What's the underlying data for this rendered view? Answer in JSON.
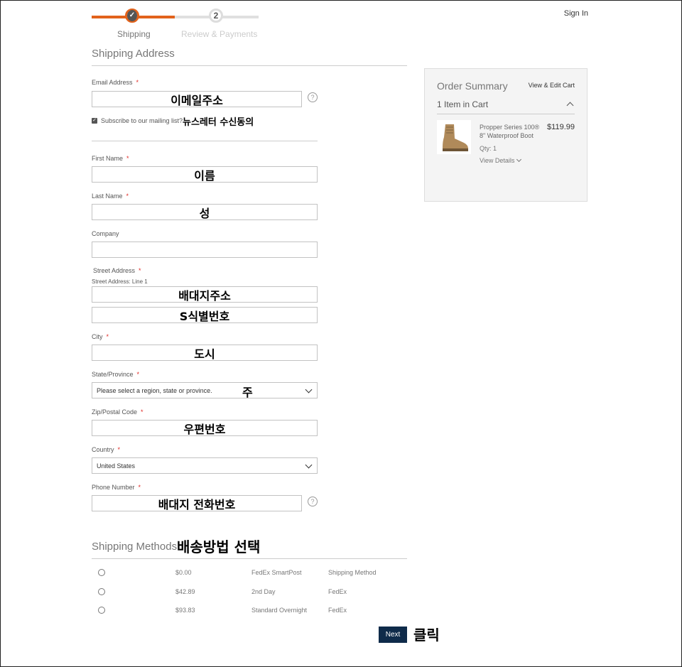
{
  "header": {
    "steps": [
      {
        "label": "Shipping",
        "state": "done",
        "icon": "check-icon"
      },
      {
        "label": "Review & Payments",
        "number": "2",
        "state": "pending"
      }
    ],
    "sign_in": "Sign In"
  },
  "shipping_address": {
    "title": "Shipping Address",
    "email": {
      "label": "Email Address",
      "annotation": "이메일주소"
    },
    "subscribe": {
      "label": "Subscribe to our mailing list?",
      "checked": true,
      "annotation": "뉴스레터 수신동의"
    },
    "first_name": {
      "label": "First Name",
      "annotation": "이름"
    },
    "last_name": {
      "label": "Last Name",
      "annotation": "성"
    },
    "company": {
      "label": "Company"
    },
    "street": {
      "label": "Street Address",
      "sublabel": "Street Address: Line 1",
      "annotation1": "배대지주소",
      "annotation2": "S식별번호"
    },
    "city": {
      "label": "City",
      "annotation": "도시"
    },
    "state": {
      "label": "State/Province",
      "value": "Please select a region, state or province.",
      "annotation": "주"
    },
    "zip": {
      "label": "Zip/Postal Code",
      "annotation": "우편번호"
    },
    "country": {
      "label": "Country",
      "value": "United States"
    },
    "phone": {
      "label": "Phone Number",
      "annotation": "배대지 전화번호"
    },
    "required_mark": "*",
    "help_mark": "?"
  },
  "order_summary": {
    "title": "Order Summary",
    "edit_link": "View & Edit Cart",
    "items_count": "1 Item in Cart",
    "item": {
      "name": "Propper Series 100® 8\" Waterproof Boot",
      "price": "$119.99",
      "qty": "Qty: 1",
      "details": "View Details"
    }
  },
  "shipping_methods": {
    "title": "Shipping Methods",
    "annotation": "배송방법 선택",
    "methods": [
      {
        "price": "$0.00",
        "method": "FedEx SmartPost",
        "carrier": "Shipping Method"
      },
      {
        "price": "$42.89",
        "method": "2nd Day",
        "carrier": "FedEx"
      },
      {
        "price": "$93.83",
        "method": "Standard Overnight",
        "carrier": "FedEx"
      }
    ]
  },
  "actions": {
    "next": "Next",
    "annotation": "클릭"
  },
  "colors": {
    "accent": "#e2621b",
    "button": "#0f2b4a",
    "required": "#e02b27"
  }
}
